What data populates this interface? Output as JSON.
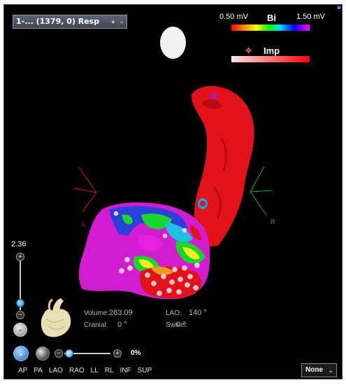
{
  "map_selector": {
    "label": "1-... (1379, 0) Resp",
    "icon": "map-points-icon"
  },
  "legend_bipolar": {
    "min": "0.50 mV",
    "name": "Bi",
    "max": "1.50 mV"
  },
  "legend_impedance": {
    "name": "Imp",
    "icon": "impedance-icon"
  },
  "orientation_labels": {
    "left": "L",
    "right": "R"
  },
  "zoom": {
    "value": "2.36",
    "plus": "+",
    "minus": "−"
  },
  "readouts": {
    "volume_label": "Volume:",
    "volume_value": "263.09",
    "lao_label": "LAO:",
    "lao_value": "140 °",
    "cranial_label": "Cranial:",
    "cranial_value": "0 °",
    "swivel_label": "Swivel:",
    "swivel_value": "0 °"
  },
  "opacity": {
    "value": "0%",
    "plus": "+",
    "minus": "−"
  },
  "views": [
    "AP",
    "PA",
    "LAO",
    "RAO",
    "LL",
    "RL",
    "INF",
    "SUP"
  ],
  "display_select": {
    "value": "None"
  },
  "colors": {
    "background": "#000000",
    "voltage_high": "#ff00ff",
    "voltage_low": "#ff0000",
    "accent": "#1b8fd6"
  }
}
